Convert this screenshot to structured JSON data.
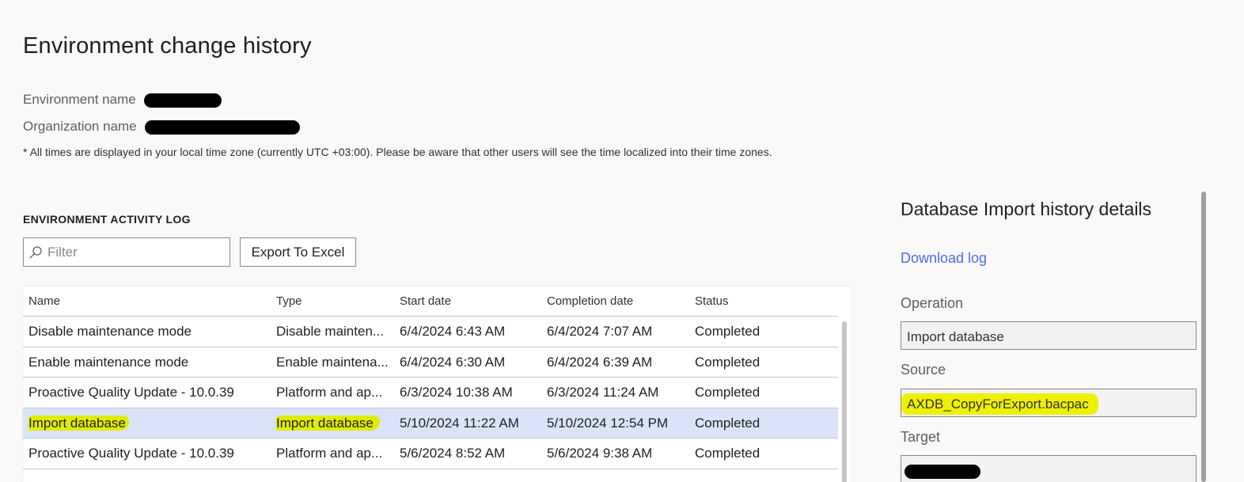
{
  "page": {
    "title": "Environment change history",
    "environment_label": "Environment name",
    "organization_label": "Organization name",
    "timezone_note": "* All times are displayed in your local time zone (currently UTC +03:00). Please be aware that other users will see the time localized into their time zones."
  },
  "activity_log": {
    "section_label": "ENVIRONMENT ACTIVITY LOG",
    "filter_placeholder": "Filter",
    "filter_icon": "search-icon",
    "export_label": "Export To Excel",
    "columns": {
      "name": "Name",
      "type": "Type",
      "start": "Start date",
      "completion": "Completion date",
      "status": "Status"
    },
    "rows": [
      {
        "name": "Disable maintenance mode",
        "type": "Disable mainten...",
        "start": "6/4/2024 6:43 AM",
        "completion": "6/4/2024 7:07 AM",
        "status": "Completed"
      },
      {
        "name": "Enable maintenance mode",
        "type": "Enable maintena...",
        "start": "6/4/2024 6:30 AM",
        "completion": "6/4/2024 6:39 AM",
        "status": "Completed"
      },
      {
        "name": "Proactive Quality Update - 10.0.39",
        "type": "Platform and ap...",
        "start": "6/3/2024 10:38 AM",
        "completion": "6/3/2024 11:24 AM",
        "status": "Completed"
      },
      {
        "name": "Import database",
        "type": "Import database",
        "start": "5/10/2024 11:22 AM",
        "completion": "5/10/2024 12:54 PM",
        "status": "Completed"
      },
      {
        "name": "Proactive Quality Update - 10.0.39",
        "type": "Platform and ap...",
        "start": "5/6/2024 8:52 AM",
        "completion": "5/6/2024 9:38 AM",
        "status": "Completed"
      }
    ]
  },
  "details": {
    "title": "Database Import history details",
    "download_label": "Download log",
    "operation_label": "Operation",
    "operation_value": "Import database",
    "source_label": "Source",
    "source_value": "AXDB_CopyForExport.bacpac",
    "target_label": "Target"
  },
  "colors": {
    "selected_row": "#dae4f8",
    "highlight": "#e2ec00",
    "link": "#4f6bed",
    "background": "#faf9f8"
  }
}
